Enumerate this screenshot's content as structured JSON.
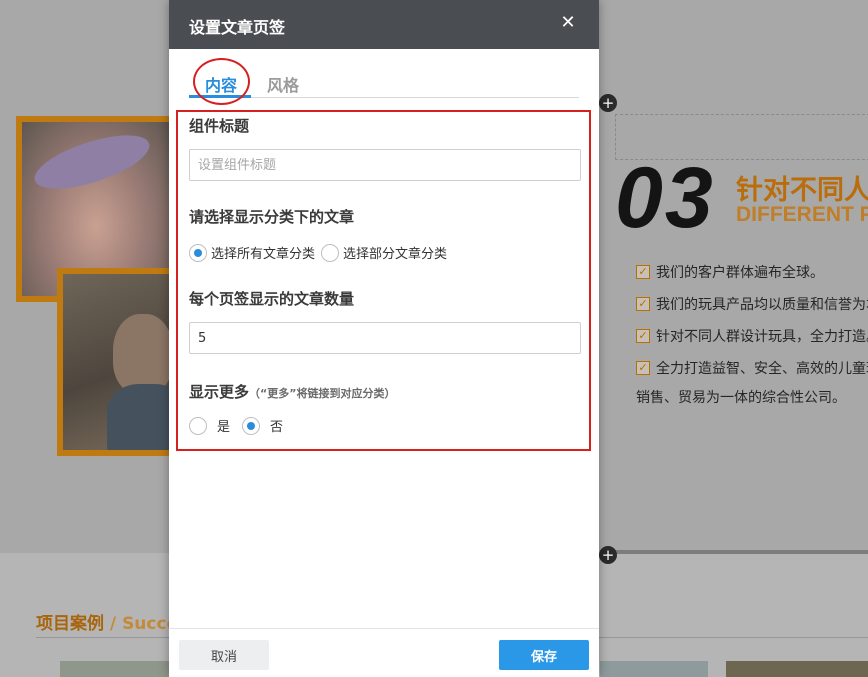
{
  "background": {
    "number": "03",
    "headline": "针对不同人群",
    "subhead": "DIFFERENT PEOPLE",
    "bullets": [
      "我们的客户群体遍布全球。",
      "我们的玩具产品均以质量和信誉为本。",
      "针对不同人群设计玩具，全力打造。",
      "全力打造益智、安全、高效的儿童玩具。"
    ],
    "tail_text": "销售、贸易为一体的综合性公司。",
    "cases_title": "项目案例",
    "cases_separator": "/",
    "cases_en": "Success",
    "add_icon_glyph": "+",
    "check_glyph": "✓"
  },
  "modal": {
    "title": "设置文章页签",
    "close_glyph": "✕",
    "tabs": [
      {
        "label": "内容",
        "active": true
      },
      {
        "label": "风格",
        "active": false
      }
    ],
    "component_title": {
      "label": "组件标题",
      "placeholder": "设置组件标题",
      "value": ""
    },
    "category": {
      "label": "请选择显示分类下的文章",
      "options": [
        {
          "label": "选择所有文章分类",
          "checked": true
        },
        {
          "label": "选择部分文章分类",
          "checked": false
        }
      ]
    },
    "count": {
      "label": "每个页签显示的文章数量",
      "value": "5"
    },
    "show_more": {
      "label": "显示更多",
      "hint": "（“更多”将链接到对应分类）",
      "options": [
        {
          "label": "是",
          "checked": false
        },
        {
          "label": "否",
          "checked": true
        }
      ]
    },
    "footer": {
      "cancel_label": "取消",
      "save_label": "保存"
    }
  },
  "colors": {
    "accent": "#2a8ddc",
    "save_button": "#2a98e6",
    "header": "#4a4d52",
    "highlight": "#d61f1f",
    "brand_orange": "#b96d0b"
  }
}
